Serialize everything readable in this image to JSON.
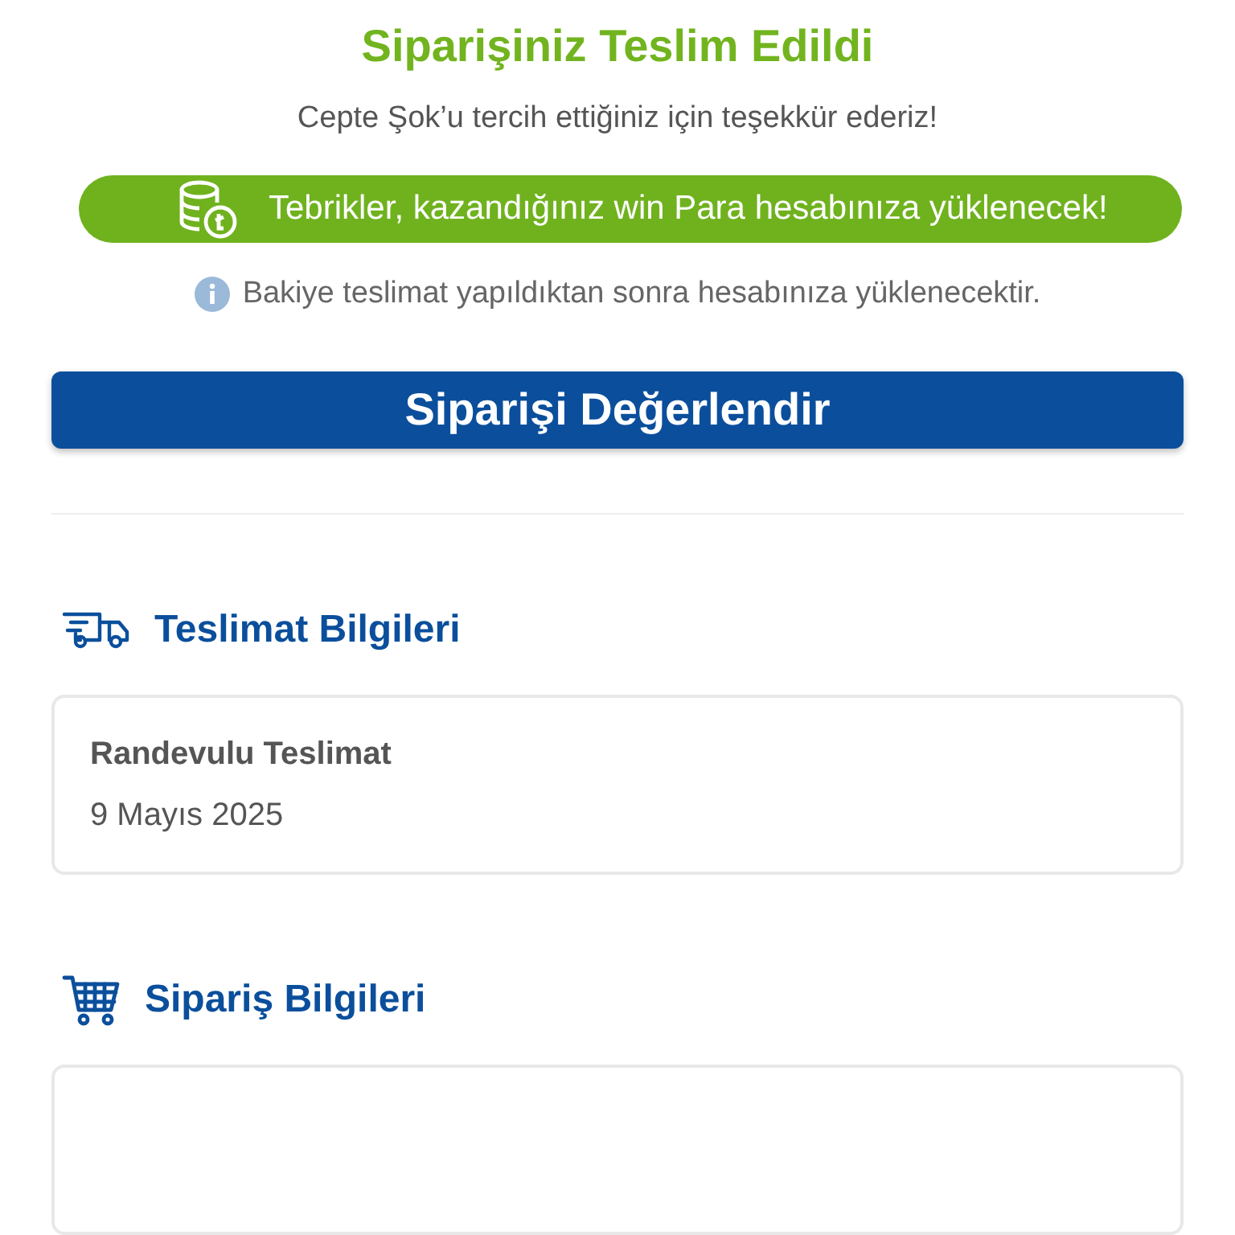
{
  "header": {
    "title": "Siparişiniz Teslim Edildi",
    "subtitle": "Cepte Şok’u tercih ettiğiniz için teşekkür ederiz!"
  },
  "reward_banner": {
    "text": "Tebrikler, kazandığınız win Para hesabınıza yüklenecek!"
  },
  "info_note": "Bakiye teslimat yapıldıktan sonra hesabınıza yüklenecektir.",
  "primary_button": "Siparişi Değerlendir",
  "sections": [
    {
      "kind": "delivery",
      "title": "Teslimat Bilgileri",
      "card": {
        "heading": "Randevulu Teslimat",
        "detail": "9 Mayıs 2025"
      }
    },
    {
      "kind": "order",
      "title": "Sipariş Bilgileri"
    }
  ]
}
